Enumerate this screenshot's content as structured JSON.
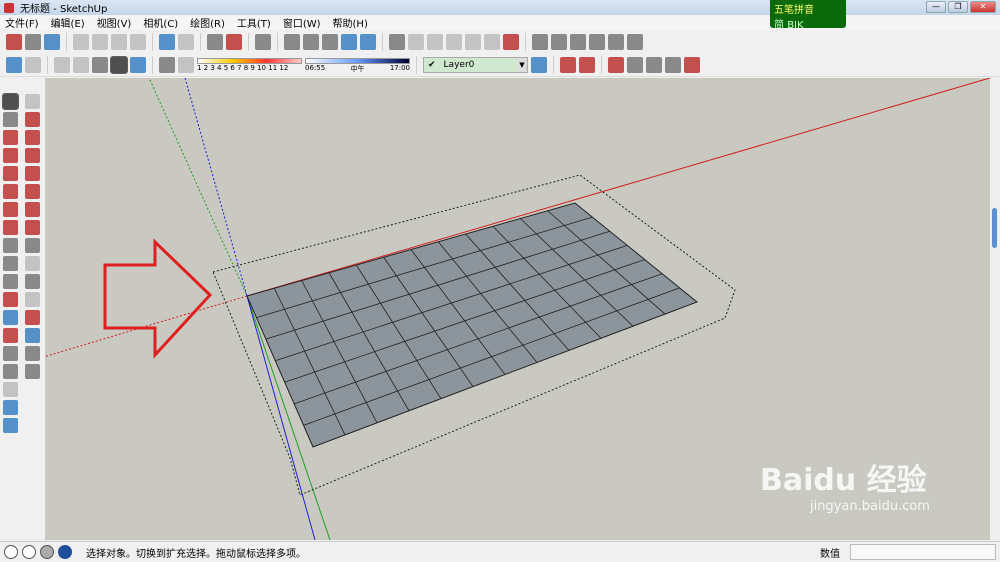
{
  "window": {
    "title": "无标题 - SketchUp",
    "minimize": "—",
    "restore": "❐",
    "close": "✕"
  },
  "ime": {
    "name": "五笔拼音",
    "mode": "简",
    "kb": "BIK"
  },
  "menu": [
    "文件(F)",
    "编辑(E)",
    "视图(V)",
    "相机(C)",
    "绘图(R)",
    "工具(T)",
    "窗口(W)",
    "帮助(H)"
  ],
  "shadow": {
    "numbers": "1 2 3 4 5 6 7 8 9 10 11 12",
    "time_start": "06:55",
    "time_mid": "中午",
    "time_end": "17:00"
  },
  "layer": {
    "checked": "✔",
    "name": "Layer0",
    "dropdown": "▼"
  },
  "status": {
    "message": "选择对象。切换到扩充选择。拖动鼠标选择多项。",
    "value_label": "数值",
    "value": ""
  },
  "watermark": {
    "brand": "Baidu 经验",
    "url": "jingyan.baidu.com"
  },
  "colors": {
    "x_axis": "#d02020",
    "y_axis": "#20a020",
    "z_axis": "#2020d0",
    "arrow": "#e02020",
    "face": "#8c949c"
  }
}
